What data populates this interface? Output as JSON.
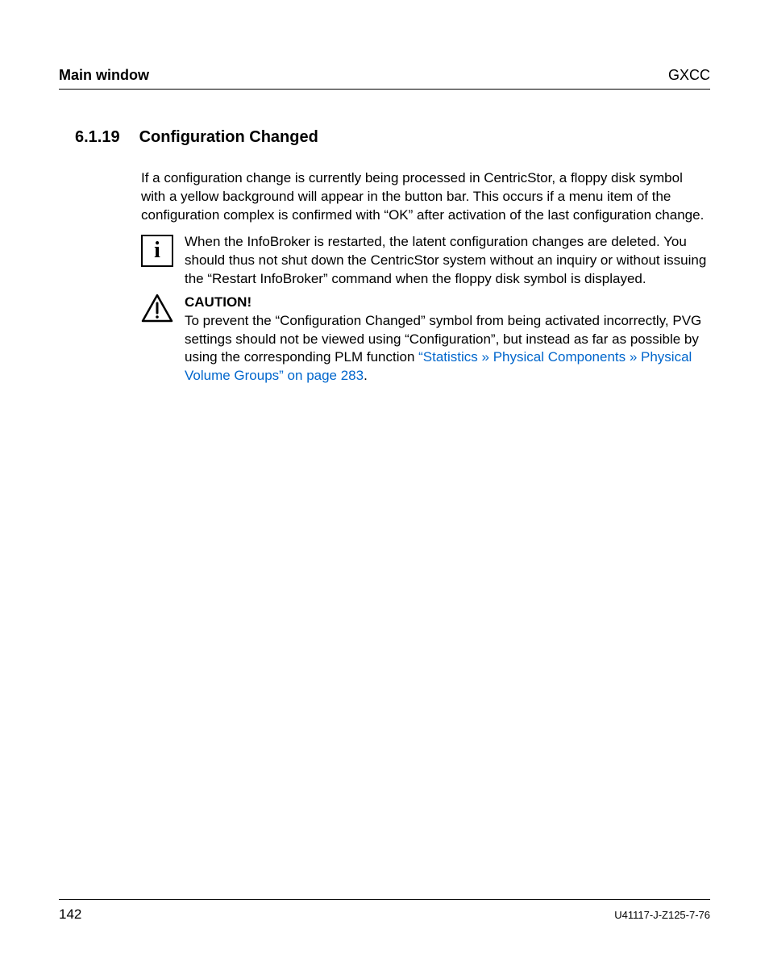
{
  "header": {
    "left": "Main window",
    "right": "GXCC"
  },
  "section": {
    "number": "6.1.19",
    "title": "Configuration Changed"
  },
  "intro_paragraph": "If a configuration change is currently being processed in CentricStor, a floppy disk symbol with a yellow background will appear in the button bar. This occurs if a menu item of the configuration complex is confirmed with “OK” after activation of the last configuration change.",
  "info_block": {
    "text": "When the InfoBroker is restarted, the latent configuration changes are deleted. You should thus not shut down the CentricStor system without an inquiry or without issuing the “Restart InfoBroker” command when the floppy disk symbol is displayed."
  },
  "caution_block": {
    "label": "CAUTION!",
    "text_before_link": "To prevent the “Configuration Changed” symbol from being activated incorrectly, PVG settings should not be viewed using “Configuration”, but instead as far as possible by using the corresponding PLM function ",
    "link_text": "“Statistics » Physical Components » Physical Volume Groups” on page 283",
    "text_after_link": "."
  },
  "footer": {
    "page": "142",
    "doc_id": "U41117-J-Z125-7-76"
  }
}
